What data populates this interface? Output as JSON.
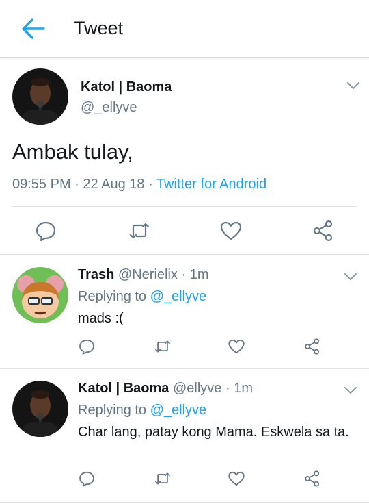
{
  "header": {
    "title": "Tweet",
    "back_icon": "arrow-left-icon",
    "accent": "#1da1f2"
  },
  "main_tweet": {
    "name": "Katol | Baoma",
    "handle": "@_ellyve",
    "text": "Ambak tulay,",
    "time": "09:55 PM",
    "sep1": "·",
    "date": "22 Aug 18",
    "sep2": "·",
    "source": "Twitter for Android",
    "actions": [
      "reply-icon",
      "retweet-icon",
      "like-icon",
      "share-icon"
    ]
  },
  "replies": [
    {
      "name": "Trash",
      "handle": "@Nerielix",
      "dot": "·",
      "time": "1m",
      "replying_label": "Replying to",
      "mention": "@_ellyve",
      "text": "mads :("
    },
    {
      "name": "Katol | Baoma",
      "handle": "@ellyve",
      "dot": "·",
      "time": "1m",
      "replying_label": "Replying to",
      "mention": "@_ellyve",
      "text": "Char lang, patay kong Mama. Eskwela sa ta."
    }
  ],
  "colors": {
    "muted": "#657786",
    "link": "#1da1f2",
    "icon": "#657786"
  }
}
